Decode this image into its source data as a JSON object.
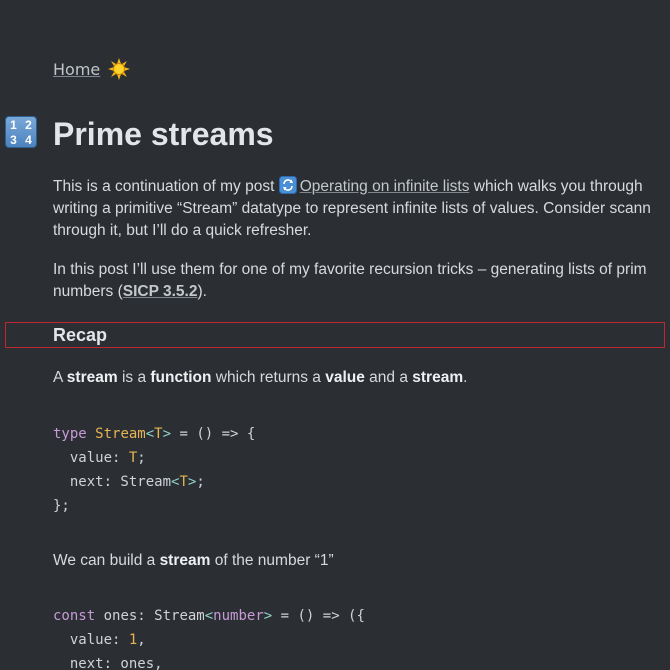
{
  "nav": {
    "home_label": "Home"
  },
  "title": {
    "emoji_digits": [
      "1",
      "2",
      "3",
      "4"
    ],
    "text": "Prime streams"
  },
  "intro": {
    "line1_pre": "This is a continuation of my post ",
    "line1_link": "Operating on infinite lists",
    "line1_post": " which walks you through",
    "line2": "writing a primitive “Stream” datatype to represent infinite lists of values. Consider scann",
    "line3": "through it, but I’ll do a quick refresher."
  },
  "intro2": {
    "line1": "In this post I’ll use them for one of my favorite recursion tricks – generating lists of prim",
    "line2_pre": "numbers (",
    "line2_link": "SICP 3.5.2",
    "line2_post": ")."
  },
  "recap": {
    "heading": "Recap"
  },
  "recap_text": {
    "p1": "A ",
    "b1": "stream",
    "p2": " is a ",
    "b2": "function",
    "p3": " which returns a ",
    "b3": "value",
    "p4": " and a ",
    "b4": "stream",
    "p5": "."
  },
  "code1": {
    "l1_kw": "type",
    "l1_name": "Stream",
    "l1_lt": "<",
    "l1_T": "T",
    "l1_gt": ">",
    "l1_rest": " = () => {",
    "l2_key": "  value: ",
    "l2_T": "T",
    "l2_end": ";",
    "l3_key": "  next: Stream",
    "l3_lt": "<",
    "l3_T": "T",
    "l3_gt": ">",
    "l3_end": ";",
    "l4": "};"
  },
  "build_text": {
    "p1": "We can build a ",
    "b1": "stream",
    "p2": " of the number “1”"
  },
  "code2": {
    "l1_kw": "const",
    "l1_mid": " ones: Stream",
    "l1_lt": "<",
    "l1_type": "number",
    "l1_gt": ">",
    "l1_rest": " = () => ({",
    "l2_key": "  value: ",
    "l2_num": "1",
    "l2_end": ",",
    "l3": "  next: ones,"
  },
  "colors": {
    "background": "#2b2f33",
    "text": "#d7dadd",
    "highlight_box": "#c0262f",
    "keyword": "#c79ad8",
    "type": "#e6b450",
    "operator": "#8fd2c8"
  }
}
